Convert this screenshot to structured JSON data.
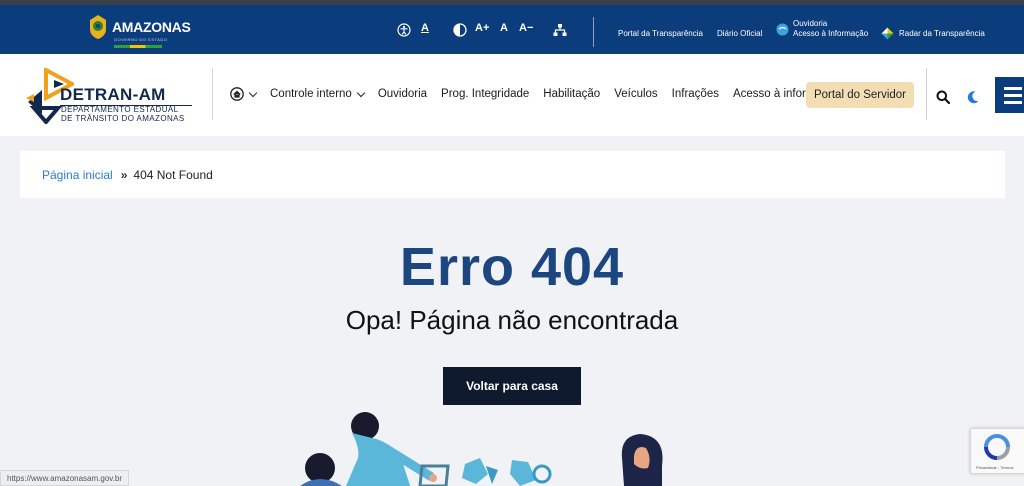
{
  "gov_bar": {
    "logo_text": "AMAZONAS",
    "logo_subtext": "GOVERNO DO ESTADO",
    "accessibility": {
      "high_contrast_a": "A",
      "font_increase": "A+",
      "font_normal": "A",
      "font_decrease": "A−"
    },
    "links": {
      "transparencia": "Portal da Transparência",
      "diario": "Diário Oficial",
      "ouvidoria_line1": "Ouvidoria",
      "ouvidoria_line2": "Acesso à Informação",
      "radar": "Radar da Transparência"
    }
  },
  "header": {
    "logo_title": "DETRAN-AM",
    "logo_sub_line1": "DEPARTAMENTO  ESTADUAL",
    "logo_sub_line2": "DE TRÂNSITO DO AMAZONAS",
    "nav": {
      "controle": "Controle interno",
      "ouvidoria": "Ouvidoria",
      "integridade": "Prog. Integridade",
      "habilitacao": "Habilitação",
      "veiculos": "Veículos",
      "infracoes": "Infrações",
      "acesso": "Acesso à informação"
    },
    "portal_button": "Portal do Servidor"
  },
  "breadcrumb": {
    "home": "Página inicial",
    "separator": "»",
    "current": "404 Not Found"
  },
  "error": {
    "title": "Erro 404",
    "subtitle": "Opa! Página não encontrada",
    "button": "Voltar para casa"
  },
  "recaptcha": {
    "text": "Privacidade - Termos"
  },
  "status_url": "https://www.amazonasam.gov.br",
  "colors": {
    "gov_bar": "#0b3c7c",
    "title": "#1c467f",
    "portal_button": "#f3deb4",
    "back_button": "#0f1a2e",
    "link": "#2a7bd4"
  }
}
